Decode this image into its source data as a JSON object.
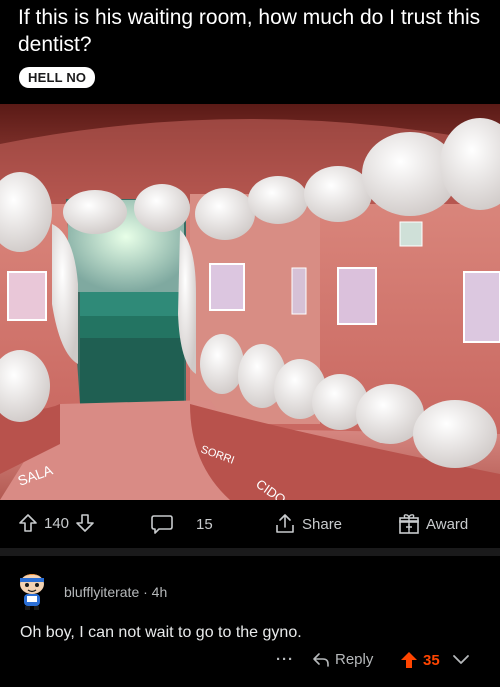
{
  "post": {
    "title": "If this is his waiting room, how much do I trust this dentist?",
    "flair": "HELL NO",
    "image_label": "Dental office waiting room shaped like a giant open mouth with teeth",
    "image_signs": [
      "CIDO",
      "SALA",
      "SORRI"
    ]
  },
  "actions": {
    "upvote_icon": "upvote-arrow-icon",
    "votes": "140",
    "downvote_icon": "downvote-arrow-icon",
    "comment_icon": "comment-bubble-icon",
    "comments": "15",
    "share_icon": "share-icon",
    "share_label": "Share",
    "award_icon": "gift-award-icon",
    "award_label": "Award"
  },
  "comment": {
    "username": "blufflyiterate",
    "age": "· 4h",
    "body": "Oh boy, I can not wait to go to the gyno.",
    "more": "···",
    "reply_label": "Reply",
    "votes": "35"
  },
  "colors": {
    "background": "#000000",
    "text": "#d7dadc",
    "upvote_active": "#ff4500",
    "flair_bg": "#ffffff"
  }
}
